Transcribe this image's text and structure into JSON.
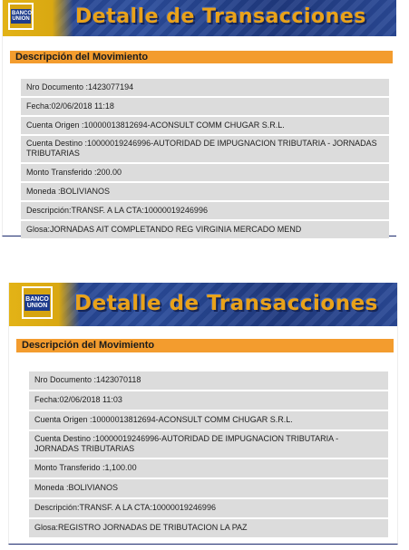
{
  "receipts": [
    {
      "logo_text": "BANCO UNION",
      "title": "Detalle de Transacciones",
      "section": "Descripción del Movimiento",
      "fields": [
        "Nro Documento :1423077194",
        "Fecha:02/06/2018 11:18",
        "Cuenta Origen :10000013812694-ACONSULT COMM CHUGAR S.R.L.",
        "Cuenta Destino :10000019246996-AUTORIDAD DE IMPUGNACION TRIBUTARIA - JORNADAS TRIBUTARIAS",
        "Monto Transferido :200.00",
        "Moneda :BOLIVIANOS",
        "Descripción:TRANSF. A LA CTA:10000019246996",
        "Glosa:JORNADAS AIT COMPLETANDO REG VIRGINIA MERCADO MEND"
      ]
    },
    {
      "logo_text": "BANCO UNION",
      "title": "Detalle de Transacciones",
      "section": "Descripción del Movimiento",
      "fields": [
        "Nro Documento :1423070118",
        "Fecha:02/06/2018 11:03",
        "Cuenta Origen :10000013812694-ACONSULT COMM CHUGAR S.R.L.",
        "Cuenta Destino :10000019246996-AUTORIDAD DE IMPUGNACION TRIBUTARIA - JORNADAS TRIBUTARIAS",
        "Monto Transferido :1,100.00",
        "Moneda :BOLIVIANOS",
        "Descripción:TRANSF. A LA CTA:10000019246996",
        "Glosa:REGISTRO JORNADAS DE TRIBUTACION LA PAZ"
      ]
    }
  ],
  "colors": {
    "banner_blue": "#233f8a",
    "title_orange": "#e9a21a",
    "section_orange": "#f39c2e",
    "field_gray": "#dcdcdc"
  }
}
